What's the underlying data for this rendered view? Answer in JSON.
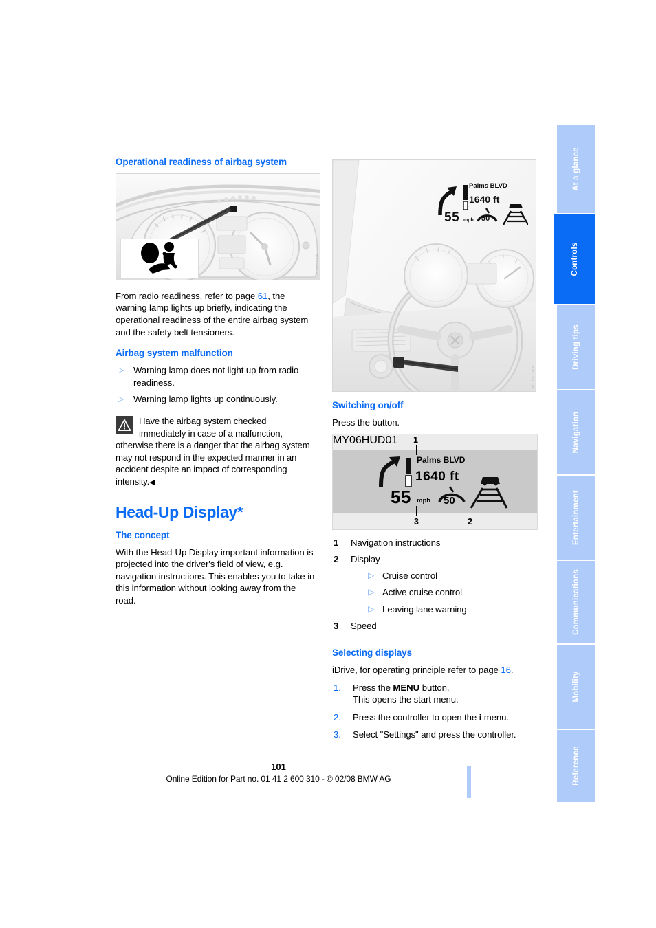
{
  "sidebar": {
    "tabs": [
      {
        "label": "At a glance",
        "active": false
      },
      {
        "label": "Controls",
        "active": true
      },
      {
        "label": "Driving tips",
        "active": false
      },
      {
        "label": "Navigation",
        "active": false
      },
      {
        "label": "Entertainment",
        "active": false
      },
      {
        "label": "Communications",
        "active": false
      },
      {
        "label": "Mobility",
        "active": false
      },
      {
        "label": "Reference",
        "active": false
      }
    ],
    "active_color": "#0a6bf5",
    "inactive_color": "#aecbfa"
  },
  "left_column": {
    "heading_airbag_readiness": "Operational readiness of airbag system",
    "figure_cluster_caption_code": "MY06011M3",
    "paragraph_readiness_pre": "From radio readiness, refer to page ",
    "paragraph_readiness_pageref": "61",
    "paragraph_readiness_post": ", the warning lamp lights up briefly, indicating the operational readiness of the entire airbag system and the safety belt tensioners.",
    "heading_malfunction": "Airbag system malfunction",
    "malfunction_items": [
      "Warning lamp does not light up from radio readiness.",
      "Warning lamp lights up continuously."
    ],
    "warning_note": "Have the airbag system checked immediately in case of a malfunction, otherwise there is a danger that the airbag system may not respond in the expected manner in an accident despite an impact of corresponding intensity.",
    "warning_end_mark": "◀",
    "heading_hud": "Head-Up Display*",
    "heading_concept": "The concept",
    "paragraph_concept": "With the Head-Up Display important information is projected into the driver's field of view, e.g. navigation instructions. This enables you to take in this information without looking away from the road."
  },
  "right_column": {
    "figure_windshield_code": "MY07SPL04",
    "hud_overlay": {
      "street": "Palms BLVD",
      "distance": "1640 ft",
      "speed": "55",
      "speed_unit": "mph",
      "speed_limit": "50"
    },
    "heading_switching": "Switching on/off",
    "paragraph_switching": "Press the button.",
    "hud_figure": {
      "code": "MY06HUD01",
      "callout_1": "1",
      "callout_2": "2",
      "callout_3": "3",
      "street": "Palms BLVD",
      "distance": "1640 ft",
      "speed": "55",
      "speed_unit": "mph",
      "speed_limit": "50"
    },
    "legend": [
      {
        "num": "1",
        "label": "Navigation instructions",
        "sub": []
      },
      {
        "num": "2",
        "label": "Display",
        "sub": [
          "Cruise control",
          "Active cruise control",
          "Leaving lane warning"
        ]
      },
      {
        "num": "3",
        "label": "Speed",
        "sub": []
      }
    ],
    "heading_selecting": "Selecting displays",
    "idrive_pre": "iDrive, for operating principle refer to page ",
    "idrive_pageref": "16",
    "idrive_post": ".",
    "steps": [
      {
        "num": "1.",
        "pre": "Press the ",
        "kbd": "MENU",
        "post": " button.",
        "second_line": "This opens the start menu."
      },
      {
        "num": "2.",
        "pre": "Press the controller to open the ",
        "kbd": "i",
        "post": " menu.",
        "second_line": ""
      },
      {
        "num": "3.",
        "pre": "Select \"Settings\" and press the controller.",
        "kbd": "",
        "post": "",
        "second_line": ""
      }
    ]
  },
  "footer": {
    "page_number": "101",
    "edition_text": "Online Edition for Part no. 01 41 2 600 310 - © 02/08 BMW AG"
  }
}
